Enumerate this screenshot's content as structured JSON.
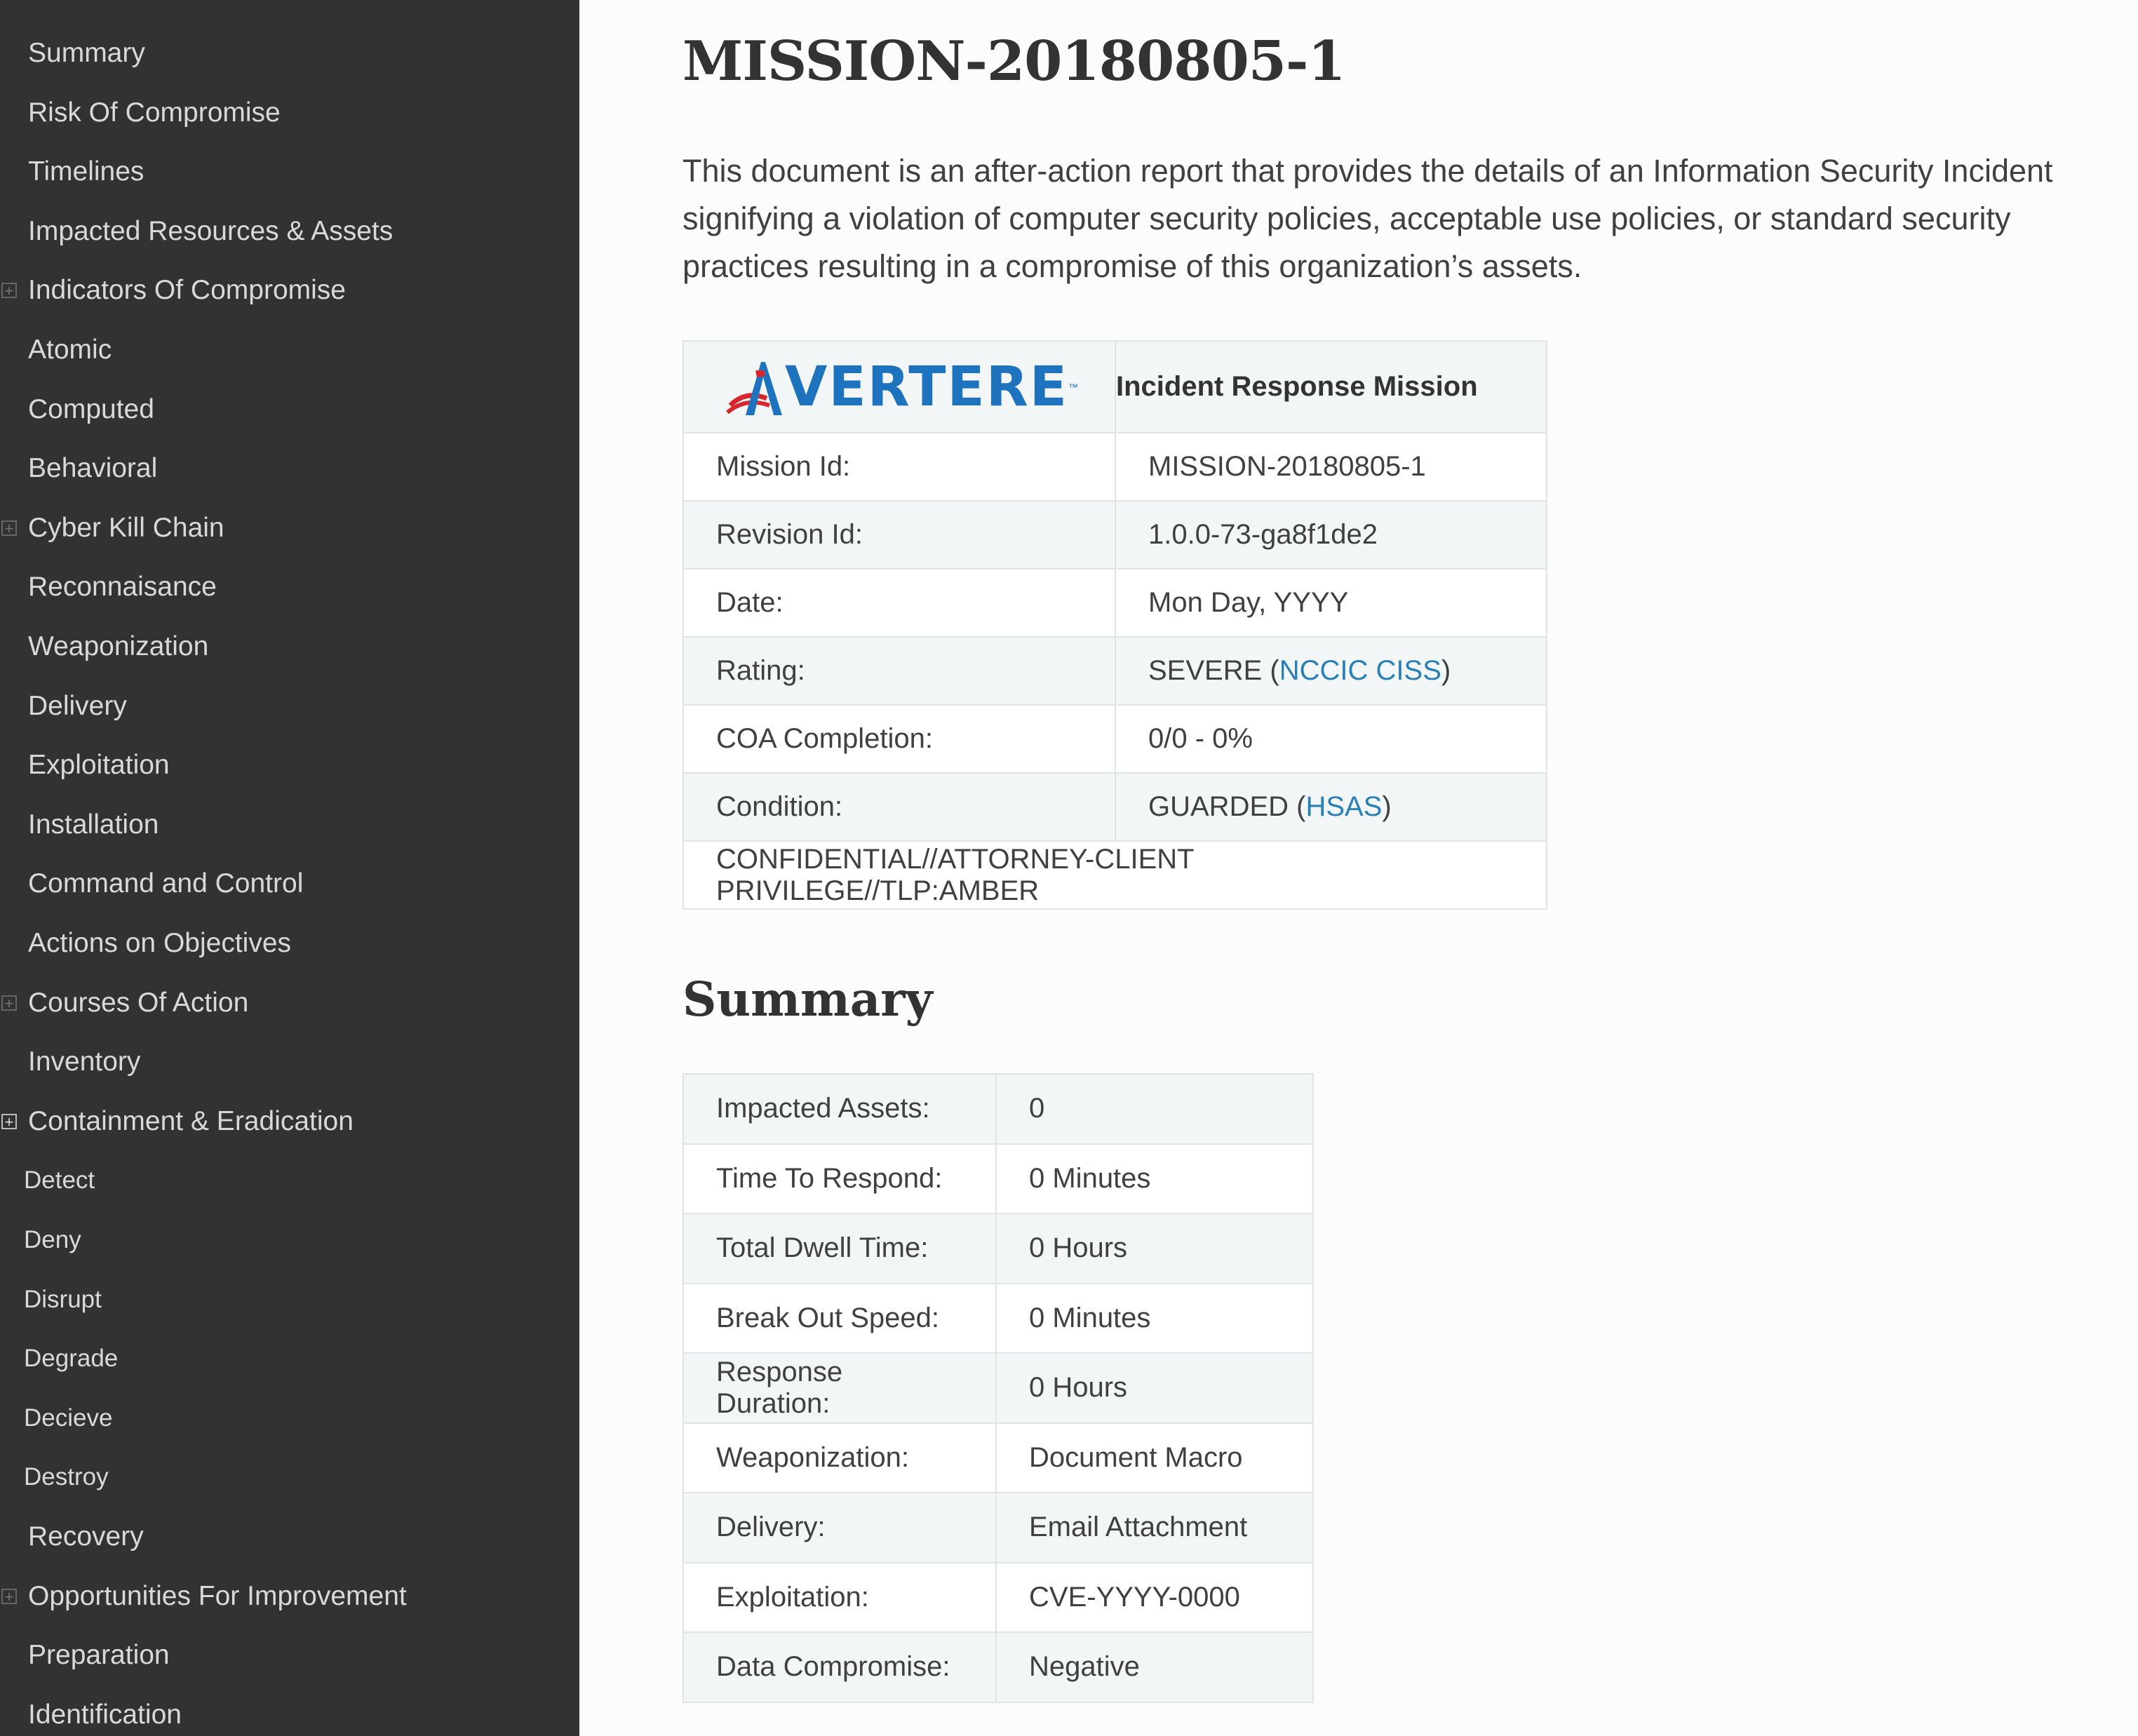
{
  "sidebar": {
    "items": [
      {
        "label": "Summary",
        "level": 1,
        "toggle": false
      },
      {
        "label": "Risk Of Compromise",
        "level": 1,
        "toggle": false
      },
      {
        "label": "Timelines",
        "level": 1,
        "toggle": false
      },
      {
        "label": "Impacted Resources & Assets",
        "level": 1,
        "toggle": false
      },
      {
        "label": "Indicators Of Compromise",
        "level": 1,
        "toggle": true
      },
      {
        "label": "Atomic",
        "level": 1,
        "toggle": false
      },
      {
        "label": "Computed",
        "level": 1,
        "toggle": false
      },
      {
        "label": "Behavioral",
        "level": 1,
        "toggle": false
      },
      {
        "label": "Cyber Kill Chain",
        "level": 1,
        "toggle": true
      },
      {
        "label": "Reconnaisance",
        "level": 1,
        "toggle": false
      },
      {
        "label": "Weaponization",
        "level": 1,
        "toggle": false
      },
      {
        "label": "Delivery",
        "level": 1,
        "toggle": false
      },
      {
        "label": "Exploitation",
        "level": 1,
        "toggle": false
      },
      {
        "label": "Installation",
        "level": 1,
        "toggle": false
      },
      {
        "label": "Command and Control",
        "level": 1,
        "toggle": false
      },
      {
        "label": "Actions on Objectives",
        "level": 1,
        "toggle": false
      },
      {
        "label": "Courses Of Action",
        "level": 1,
        "toggle": true
      },
      {
        "label": "Inventory",
        "level": 1,
        "toggle": false
      },
      {
        "label": "Containment & Eradication",
        "level": 1,
        "toggle": true
      },
      {
        "label": "Detect",
        "level": 2,
        "toggle": false
      },
      {
        "label": "Deny",
        "level": 2,
        "toggle": false
      },
      {
        "label": "Disrupt",
        "level": 2,
        "toggle": false
      },
      {
        "label": "Degrade",
        "level": 2,
        "toggle": false
      },
      {
        "label": "Decieve",
        "level": 2,
        "toggle": false
      },
      {
        "label": "Destroy",
        "level": 2,
        "toggle": false
      },
      {
        "label": "Recovery",
        "level": 1,
        "toggle": false
      },
      {
        "label": "Opportunities For Improvement",
        "level": 1,
        "toggle": true
      },
      {
        "label": "Preparation",
        "level": 1,
        "toggle": false
      },
      {
        "label": "Identification",
        "level": 1,
        "toggle": false
      }
    ]
  },
  "page": {
    "title": "MISSION-20180805-1",
    "intro": "This document is an after-action report that provides the details of an Information Security Incident signifying a violation of computer security policies, acceptable use policies, or standard security practices resulting in a compromise of this organization’s assets."
  },
  "mission_table": {
    "logo_text": "VERTERE",
    "logo_tm": "™",
    "header": "Incident Response Mission",
    "mission_id_label": "Mission Id:",
    "mission_id": "MISSION-20180805-1",
    "revision_label": "Revision Id:",
    "revision": "1.0.0-73-ga8f1de2",
    "date_label": "Date:",
    "date": "Mon Day, YYYY",
    "rating_label": "Rating:",
    "rating_value": "SEVERE",
    "rating_link": "NCCIC CISS",
    "coa_label": "COA Completion:",
    "coa": "0/0 - 0%",
    "condition_label": "Condition:",
    "condition_value": "GUARDED",
    "condition_link": "HSAS",
    "classification": "CONFIDENTIAL//ATTORNEY-CLIENT PRIVILEGE//TLP:AMBER"
  },
  "summary": {
    "heading": "Summary",
    "rows": [
      {
        "label": "Impacted Assets:",
        "value": "0"
      },
      {
        "label": "Time To Respond:",
        "value": "0 Minutes"
      },
      {
        "label": "Total Dwell Time:",
        "value": "0 Hours"
      },
      {
        "label": "Break Out Speed:",
        "value": "0 Minutes"
      },
      {
        "label": "Response Duration:",
        "value": "0 Hours"
      },
      {
        "label": "Weaponization:",
        "value": "Document Macro"
      },
      {
        "label": "Delivery:",
        "value": "Email Attachment"
      },
      {
        "label": "Exploitation:",
        "value": "CVE-YYYY-0000"
      },
      {
        "label": "Data Compromise:",
        "value": "Negative"
      }
    ]
  },
  "colors": {
    "sidebar_bg": "#343131",
    "link": "#2980b9",
    "logo_blue": "#1e73be",
    "logo_red": "#d9262e"
  }
}
